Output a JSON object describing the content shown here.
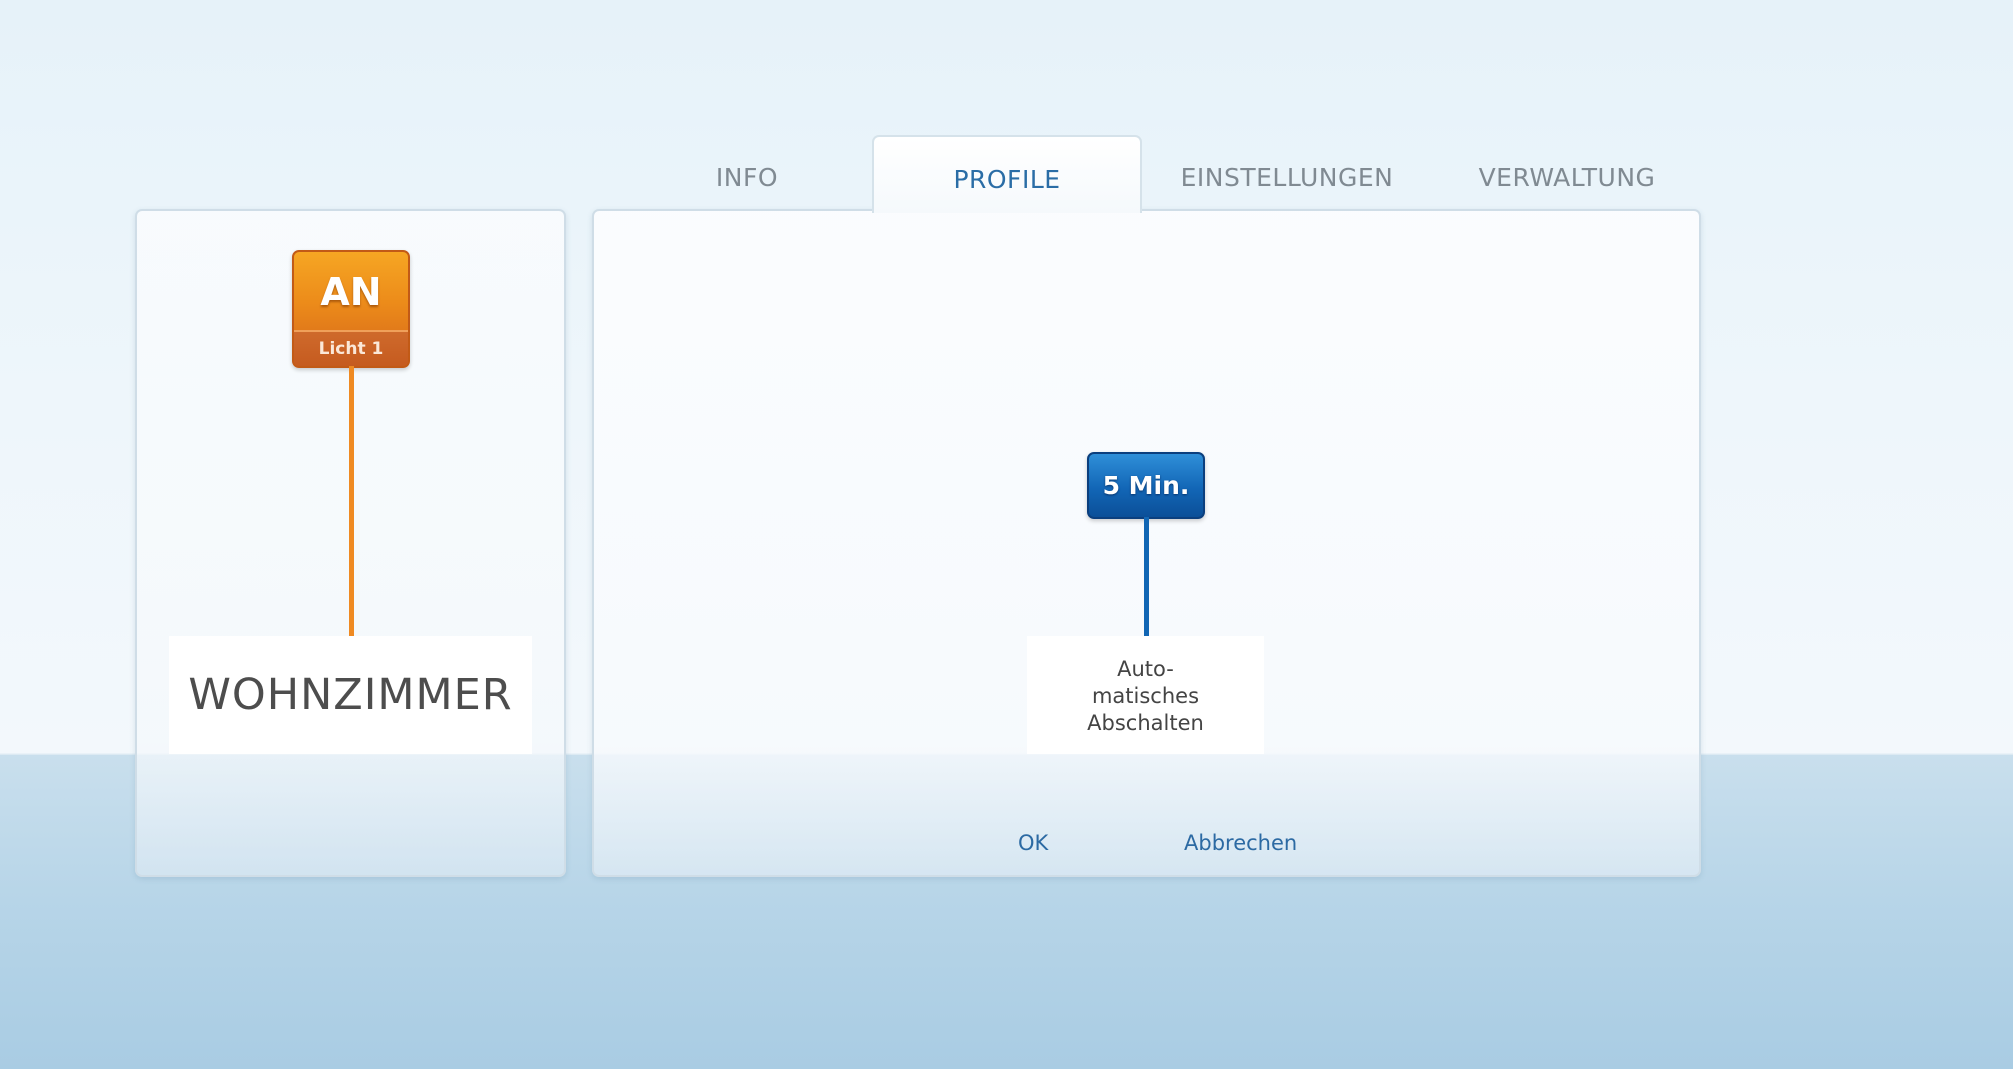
{
  "tabs": [
    {
      "label": "INFO",
      "active": false
    },
    {
      "label": "PROFILE",
      "active": true
    },
    {
      "label": "EINSTELLUNGEN",
      "active": false
    },
    {
      "label": "VERWALTUNG",
      "active": false
    }
  ],
  "left_panel": {
    "status_tile": {
      "state": "AN",
      "device": "Licht 1",
      "color": "#ec8b1a"
    },
    "room_name": "WOHNZIMMER"
  },
  "profile": {
    "timer_label": "5 Min.",
    "timer_color": "#1266b6",
    "name_lines": [
      "Auto-",
      "matisches",
      "Abschalten"
    ]
  },
  "actions": {
    "ok_label": "OK",
    "cancel_label": "Abbrechen"
  }
}
